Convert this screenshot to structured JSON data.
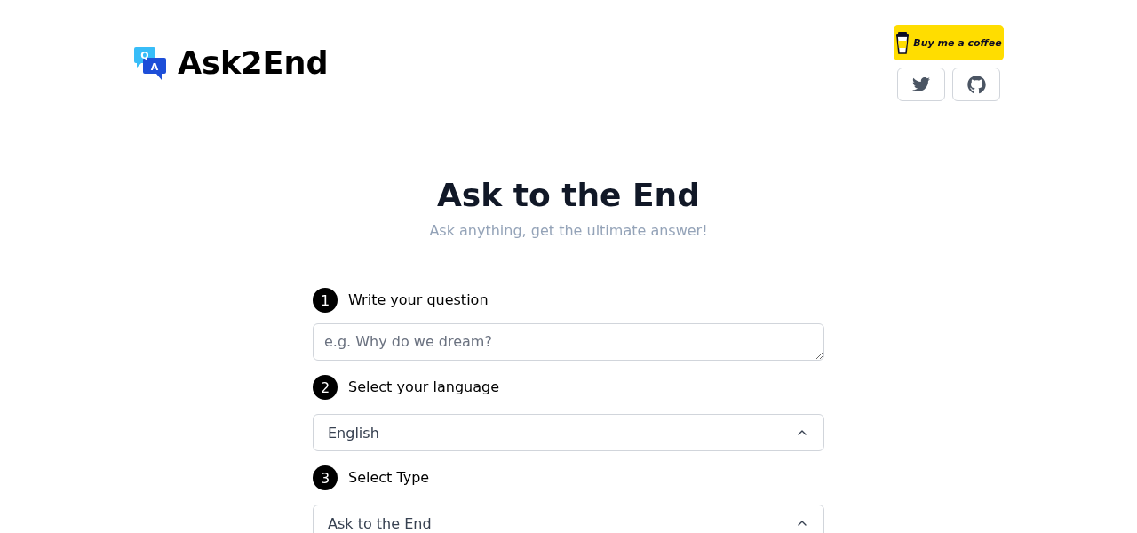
{
  "header": {
    "logo": {
      "text": "Ask2End",
      "icon_letters": [
        "Q",
        "A"
      ]
    },
    "coffee_button": "Buy me a coffee",
    "social_links": [
      {
        "kind": "twitter"
      },
      {
        "kind": "github"
      }
    ]
  },
  "hero": {
    "title": "Ask to the End",
    "subtitle": "Ask anything, get the ultimate answer!"
  },
  "steps": [
    {
      "number": "1",
      "label": "Write your question",
      "field": {
        "kind": "textarea",
        "placeholder": "e.g. Why do we dream?"
      }
    },
    {
      "number": "2",
      "label": "Select your language",
      "field": {
        "kind": "select",
        "value": "English"
      }
    },
    {
      "number": "3",
      "label": "Select Type",
      "field": {
        "kind": "select",
        "value": "Ask to the End"
      }
    }
  ]
}
